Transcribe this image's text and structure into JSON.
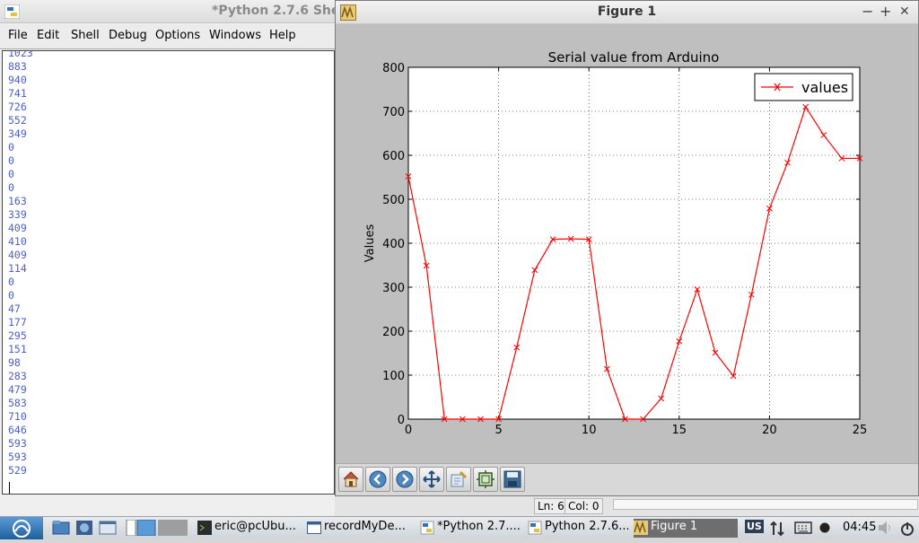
{
  "shell": {
    "title": "*Python 2.7.6 She",
    "menu": [
      "File",
      "Edit",
      "Shell",
      "Debug",
      "Options",
      "Windows",
      "Help"
    ],
    "lines": [
      "1023",
      "883",
      "940",
      "741",
      "726",
      "552",
      "349",
      "0",
      "0",
      "0",
      "0",
      "163",
      "339",
      "409",
      "410",
      "409",
      "114",
      "0",
      "0",
      "47",
      "177",
      "295",
      "151",
      "98",
      "283",
      "479",
      "583",
      "710",
      "646",
      "593",
      "593",
      "529"
    ]
  },
  "figure": {
    "title": "Figure 1",
    "minimize": "−",
    "maximize": "+",
    "close": "✕",
    "toolbar": [
      "home-icon",
      "back-icon",
      "forward-icon",
      "pan-icon",
      "zoom-icon",
      "subplots-icon",
      "save-icon"
    ]
  },
  "status": {
    "line": "Ln: 6",
    "col": "Col: 0"
  },
  "chart_data": {
    "type": "line",
    "title": "Serial value from Arduino",
    "xlabel": "",
    "ylabel": "Values",
    "xlim": [
      0,
      25
    ],
    "ylim": [
      0,
      800
    ],
    "xticks": [
      "0",
      "5",
      "10",
      "15",
      "20",
      "25"
    ],
    "yticks": [
      "0",
      "100",
      "200",
      "300",
      "400",
      "500",
      "600",
      "700",
      "800"
    ],
    "grid": true,
    "legend_position": "top-right",
    "color": "#ff0000",
    "marker": "x",
    "series": [
      {
        "name": "values",
        "x": [
          0,
          1,
          2,
          3,
          4,
          5,
          6,
          7,
          8,
          9,
          10,
          11,
          12,
          13,
          14,
          15,
          16,
          17,
          18,
          19,
          20,
          21,
          22,
          23,
          24,
          25
        ],
        "values": [
          552,
          349,
          0,
          0,
          0,
          0,
          163,
          339,
          409,
          410,
          409,
          114,
          0,
          0,
          47,
          177,
          295,
          151,
          98,
          283,
          479,
          583,
          710,
          646,
          593,
          593
        ]
      }
    ]
  },
  "taskbar": {
    "tasks": [
      {
        "label": "eric@pcUbu..."
      },
      {
        "label": "recordMyDe..."
      },
      {
        "label": "*Python 2.7...."
      },
      {
        "label": "Python 2.7.6..."
      },
      {
        "label": "Figure 1"
      }
    ],
    "keyboard_layout": "US",
    "clock": "04:45"
  }
}
